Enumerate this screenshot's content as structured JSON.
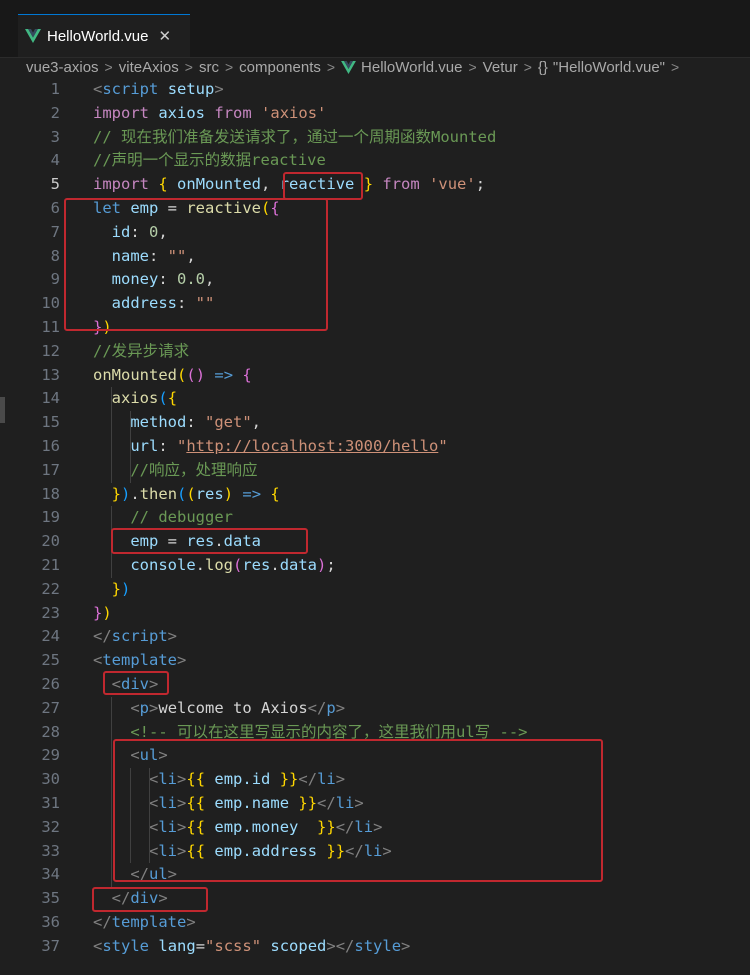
{
  "tab": {
    "title": "HelloWorld.vue",
    "close_glyph": "✕",
    "icon": "vue-icon",
    "accent": "#41b883"
  },
  "breadcrumb": {
    "segments": [
      "vue3-axios",
      "viteAxios",
      "src",
      "components",
      "HelloWorld.vue",
      "Vetur",
      "\"HelloWorld.vue\""
    ],
    "braces": "{}",
    "separator": ">"
  },
  "editor": {
    "active_line": 5,
    "lines": [
      {
        "n": "1"
      },
      {
        "n": "2"
      },
      {
        "n": "3"
      },
      {
        "n": "4"
      },
      {
        "n": "5"
      },
      {
        "n": "6"
      },
      {
        "n": "7"
      },
      {
        "n": "8"
      },
      {
        "n": "9"
      },
      {
        "n": "10"
      },
      {
        "n": "11"
      },
      {
        "n": "12"
      },
      {
        "n": "13"
      },
      {
        "n": "14"
      },
      {
        "n": "15"
      },
      {
        "n": "16"
      },
      {
        "n": "17"
      },
      {
        "n": "18"
      },
      {
        "n": "19"
      },
      {
        "n": "20"
      },
      {
        "n": "21"
      },
      {
        "n": "22"
      },
      {
        "n": "23"
      },
      {
        "n": "24"
      },
      {
        "n": "25"
      },
      {
        "n": "26"
      },
      {
        "n": "27"
      },
      {
        "n": "28"
      },
      {
        "n": "29"
      },
      {
        "n": "30"
      },
      {
        "n": "31"
      },
      {
        "n": "32"
      },
      {
        "n": "33"
      },
      {
        "n": "34"
      },
      {
        "n": "35"
      },
      {
        "n": "36"
      },
      {
        "n": "37"
      }
    ],
    "code": [
      [
        [
          "t-tag",
          "<"
        ],
        [
          "t-tagname",
          "script"
        ],
        [
          "t-plain",
          " "
        ],
        [
          "t-attr",
          "setup"
        ],
        [
          "t-tag",
          ">"
        ]
      ],
      [
        [
          "t-kw",
          "import"
        ],
        [
          "t-plain",
          " "
        ],
        [
          "t-var",
          "axios"
        ],
        [
          "t-plain",
          " "
        ],
        [
          "t-kw",
          "from"
        ],
        [
          "t-plain",
          " "
        ],
        [
          "t-str",
          "'axios'"
        ]
      ],
      [
        [
          "t-com",
          "// 现在我们准备发送请求了，通过一个周期函数Mounted"
        ]
      ],
      [
        [
          "t-com",
          "//声明一个显示的数据reactive"
        ]
      ],
      [
        [
          "t-kw",
          "import"
        ],
        [
          "t-plain",
          " "
        ],
        [
          "t-b1",
          "{"
        ],
        [
          "t-plain",
          " "
        ],
        [
          "t-var",
          "onMounted"
        ],
        [
          "t-plain",
          ", "
        ],
        [
          "t-var",
          "reactive"
        ],
        [
          "t-plain",
          " "
        ],
        [
          "t-b1",
          "}"
        ],
        [
          "t-plain",
          " "
        ],
        [
          "t-kw",
          "from"
        ],
        [
          "t-plain",
          " "
        ],
        [
          "t-str",
          "'vue'"
        ],
        [
          "t-plain",
          ";"
        ]
      ],
      [
        [
          "t-let",
          "let"
        ],
        [
          "t-plain",
          " "
        ],
        [
          "t-var",
          "emp"
        ],
        [
          "t-plain",
          " = "
        ],
        [
          "t-fn",
          "reactive"
        ],
        [
          "t-b1",
          "("
        ],
        [
          "t-b2",
          "{"
        ]
      ],
      [
        [
          "t-plain",
          "  "
        ],
        [
          "t-var",
          "id"
        ],
        [
          "t-plain",
          ": "
        ],
        [
          "t-num",
          "0"
        ],
        [
          "t-plain",
          ","
        ]
      ],
      [
        [
          "t-plain",
          "  "
        ],
        [
          "t-var",
          "name"
        ],
        [
          "t-plain",
          ": "
        ],
        [
          "t-str",
          "\"\""
        ],
        [
          "t-plain",
          ","
        ]
      ],
      [
        [
          "t-plain",
          "  "
        ],
        [
          "t-var",
          "money"
        ],
        [
          "t-plain",
          ": "
        ],
        [
          "t-num",
          "0.0"
        ],
        [
          "t-plain",
          ","
        ]
      ],
      [
        [
          "t-plain",
          "  "
        ],
        [
          "t-var",
          "address"
        ],
        [
          "t-plain",
          ": "
        ],
        [
          "t-str",
          "\"\""
        ]
      ],
      [
        [
          "t-b2",
          "}"
        ],
        [
          "t-b1",
          ")"
        ]
      ],
      [
        [
          "t-com",
          "//发异步请求"
        ]
      ],
      [
        [
          "t-fn",
          "onMounted"
        ],
        [
          "t-b1",
          "("
        ],
        [
          "t-b2",
          "("
        ],
        [
          "t-b2",
          ")"
        ],
        [
          "t-plain",
          " "
        ],
        [
          "t-let",
          "=>"
        ],
        [
          "t-plain",
          " "
        ],
        [
          "t-b2",
          "{"
        ]
      ],
      [
        [
          "t-plain",
          "  "
        ],
        [
          "t-fn",
          "axios"
        ],
        [
          "t-b3",
          "("
        ],
        [
          "t-b1",
          "{"
        ]
      ],
      [
        [
          "t-plain",
          "    "
        ],
        [
          "t-var",
          "method"
        ],
        [
          "t-plain",
          ": "
        ],
        [
          "t-str",
          "\"get\""
        ],
        [
          "t-plain",
          ","
        ]
      ],
      [
        [
          "t-plain",
          "    "
        ],
        [
          "t-var",
          "url"
        ],
        [
          "t-plain",
          ": "
        ],
        [
          "t-str",
          "\""
        ],
        [
          "t-url",
          "http://localhost:3000/hello"
        ],
        [
          "t-str",
          "\""
        ]
      ],
      [
        [
          "t-plain",
          "    "
        ],
        [
          "t-com",
          "//响应，处理响应"
        ]
      ],
      [
        [
          "t-plain",
          "  "
        ],
        [
          "t-b1",
          "}"
        ],
        [
          "t-b3",
          ")"
        ],
        [
          "t-plain",
          "."
        ],
        [
          "t-fn",
          "then"
        ],
        [
          "t-b3",
          "("
        ],
        [
          "t-b1",
          "("
        ],
        [
          "t-var",
          "res"
        ],
        [
          "t-b1",
          ")"
        ],
        [
          "t-plain",
          " "
        ],
        [
          "t-let",
          "=>"
        ],
        [
          "t-plain",
          " "
        ],
        [
          "t-b1",
          "{"
        ]
      ],
      [
        [
          "t-plain",
          "    "
        ],
        [
          "t-com",
          "// debugger"
        ]
      ],
      [
        [
          "t-plain",
          "    "
        ],
        [
          "t-var",
          "emp"
        ],
        [
          "t-plain",
          " = "
        ],
        [
          "t-var",
          "res"
        ],
        [
          "t-plain",
          "."
        ],
        [
          "t-var",
          "data"
        ]
      ],
      [
        [
          "t-plain",
          "    "
        ],
        [
          "t-var",
          "console"
        ],
        [
          "t-plain",
          "."
        ],
        [
          "t-fn",
          "log"
        ],
        [
          "t-b2",
          "("
        ],
        [
          "t-var",
          "res"
        ],
        [
          "t-plain",
          "."
        ],
        [
          "t-var",
          "data"
        ],
        [
          "t-b2",
          ")"
        ],
        [
          "t-plain",
          ";"
        ]
      ],
      [
        [
          "t-plain",
          "  "
        ],
        [
          "t-b1",
          "}"
        ],
        [
          "t-b3",
          ")"
        ]
      ],
      [
        [
          "t-b2",
          "}"
        ],
        [
          "t-b1",
          ")"
        ]
      ],
      [
        [
          "t-tag",
          "</"
        ],
        [
          "t-tagname",
          "script"
        ],
        [
          "t-tag",
          ">"
        ]
      ],
      [
        [
          "t-tag",
          "<"
        ],
        [
          "t-tagname",
          "template"
        ],
        [
          "t-tag",
          ">"
        ]
      ],
      [
        [
          "t-plain",
          "  "
        ],
        [
          "t-tag",
          "<"
        ],
        [
          "t-tagname",
          "div"
        ],
        [
          "t-tag",
          ">"
        ]
      ],
      [
        [
          "t-plain",
          "    "
        ],
        [
          "t-tag",
          "<"
        ],
        [
          "t-tagname",
          "p"
        ],
        [
          "t-tag",
          ">"
        ],
        [
          "t-text",
          "welcome to Axios"
        ],
        [
          "t-tag",
          "</"
        ],
        [
          "t-tagname",
          "p"
        ],
        [
          "t-tag",
          ">"
        ]
      ],
      [
        [
          "t-plain",
          "    "
        ],
        [
          "t-ctag",
          "<!-- 可以在这里写显示的内容了，这里我们用ul写 -->"
        ]
      ],
      [
        [
          "t-plain",
          "    "
        ],
        [
          "t-tag",
          "<"
        ],
        [
          "t-tagname",
          "ul"
        ],
        [
          "t-tag",
          ">"
        ]
      ],
      [
        [
          "t-plain",
          "      "
        ],
        [
          "t-tag",
          "<"
        ],
        [
          "t-tagname",
          "li"
        ],
        [
          "t-tag",
          ">"
        ],
        [
          "t-b1",
          "{{"
        ],
        [
          "t-plain",
          " "
        ],
        [
          "t-var",
          "emp.id"
        ],
        [
          "t-plain",
          " "
        ],
        [
          "t-b1",
          "}}"
        ],
        [
          "t-tag",
          "</"
        ],
        [
          "t-tagname",
          "li"
        ],
        [
          "t-tag",
          ">"
        ]
      ],
      [
        [
          "t-plain",
          "      "
        ],
        [
          "t-tag",
          "<"
        ],
        [
          "t-tagname",
          "li"
        ],
        [
          "t-tag",
          ">"
        ],
        [
          "t-b1",
          "{{"
        ],
        [
          "t-plain",
          " "
        ],
        [
          "t-var",
          "emp.name"
        ],
        [
          "t-plain",
          " "
        ],
        [
          "t-b1",
          "}}"
        ],
        [
          "t-tag",
          "</"
        ],
        [
          "t-tagname",
          "li"
        ],
        [
          "t-tag",
          ">"
        ]
      ],
      [
        [
          "t-plain",
          "      "
        ],
        [
          "t-tag",
          "<"
        ],
        [
          "t-tagname",
          "li"
        ],
        [
          "t-tag",
          ">"
        ],
        [
          "t-b1",
          "{{"
        ],
        [
          "t-plain",
          " "
        ],
        [
          "t-var",
          "emp.money"
        ],
        [
          "t-plain",
          "  "
        ],
        [
          "t-b1",
          "}}"
        ],
        [
          "t-tag",
          "</"
        ],
        [
          "t-tagname",
          "li"
        ],
        [
          "t-tag",
          ">"
        ]
      ],
      [
        [
          "t-plain",
          "      "
        ],
        [
          "t-tag",
          "<"
        ],
        [
          "t-tagname",
          "li"
        ],
        [
          "t-tag",
          ">"
        ],
        [
          "t-b1",
          "{{"
        ],
        [
          "t-plain",
          " "
        ],
        [
          "t-var",
          "emp.address"
        ],
        [
          "t-plain",
          " "
        ],
        [
          "t-b1",
          "}}"
        ],
        [
          "t-tag",
          "</"
        ],
        [
          "t-tagname",
          "li"
        ],
        [
          "t-tag",
          ">"
        ]
      ],
      [
        [
          "t-plain",
          "    "
        ],
        [
          "t-tag",
          "</"
        ],
        [
          "t-tagname",
          "ul"
        ],
        [
          "t-tag",
          ">"
        ]
      ],
      [
        [
          "t-plain",
          "  "
        ],
        [
          "t-tag",
          "</"
        ],
        [
          "t-tagname",
          "div"
        ],
        [
          "t-tag",
          ">"
        ]
      ],
      [
        [
          "t-tag",
          "</"
        ],
        [
          "t-tagname",
          "template"
        ],
        [
          "t-tag",
          ">"
        ]
      ],
      [
        [
          "t-tag",
          "<"
        ],
        [
          "t-tagname",
          "style"
        ],
        [
          "t-plain",
          " "
        ],
        [
          "t-attr",
          "lang"
        ],
        [
          "t-plain",
          "="
        ],
        [
          "t-str",
          "\"scss\""
        ],
        [
          "t-plain",
          " "
        ],
        [
          "t-attr",
          "scoped"
        ],
        [
          "t-tag",
          "></"
        ],
        [
          "t-tagname",
          "style"
        ],
        [
          "t-tag",
          ">"
        ]
      ]
    ]
  },
  "colors": {
    "highlight_box": "#c0282f",
    "tab_accent": "#0078d4"
  }
}
